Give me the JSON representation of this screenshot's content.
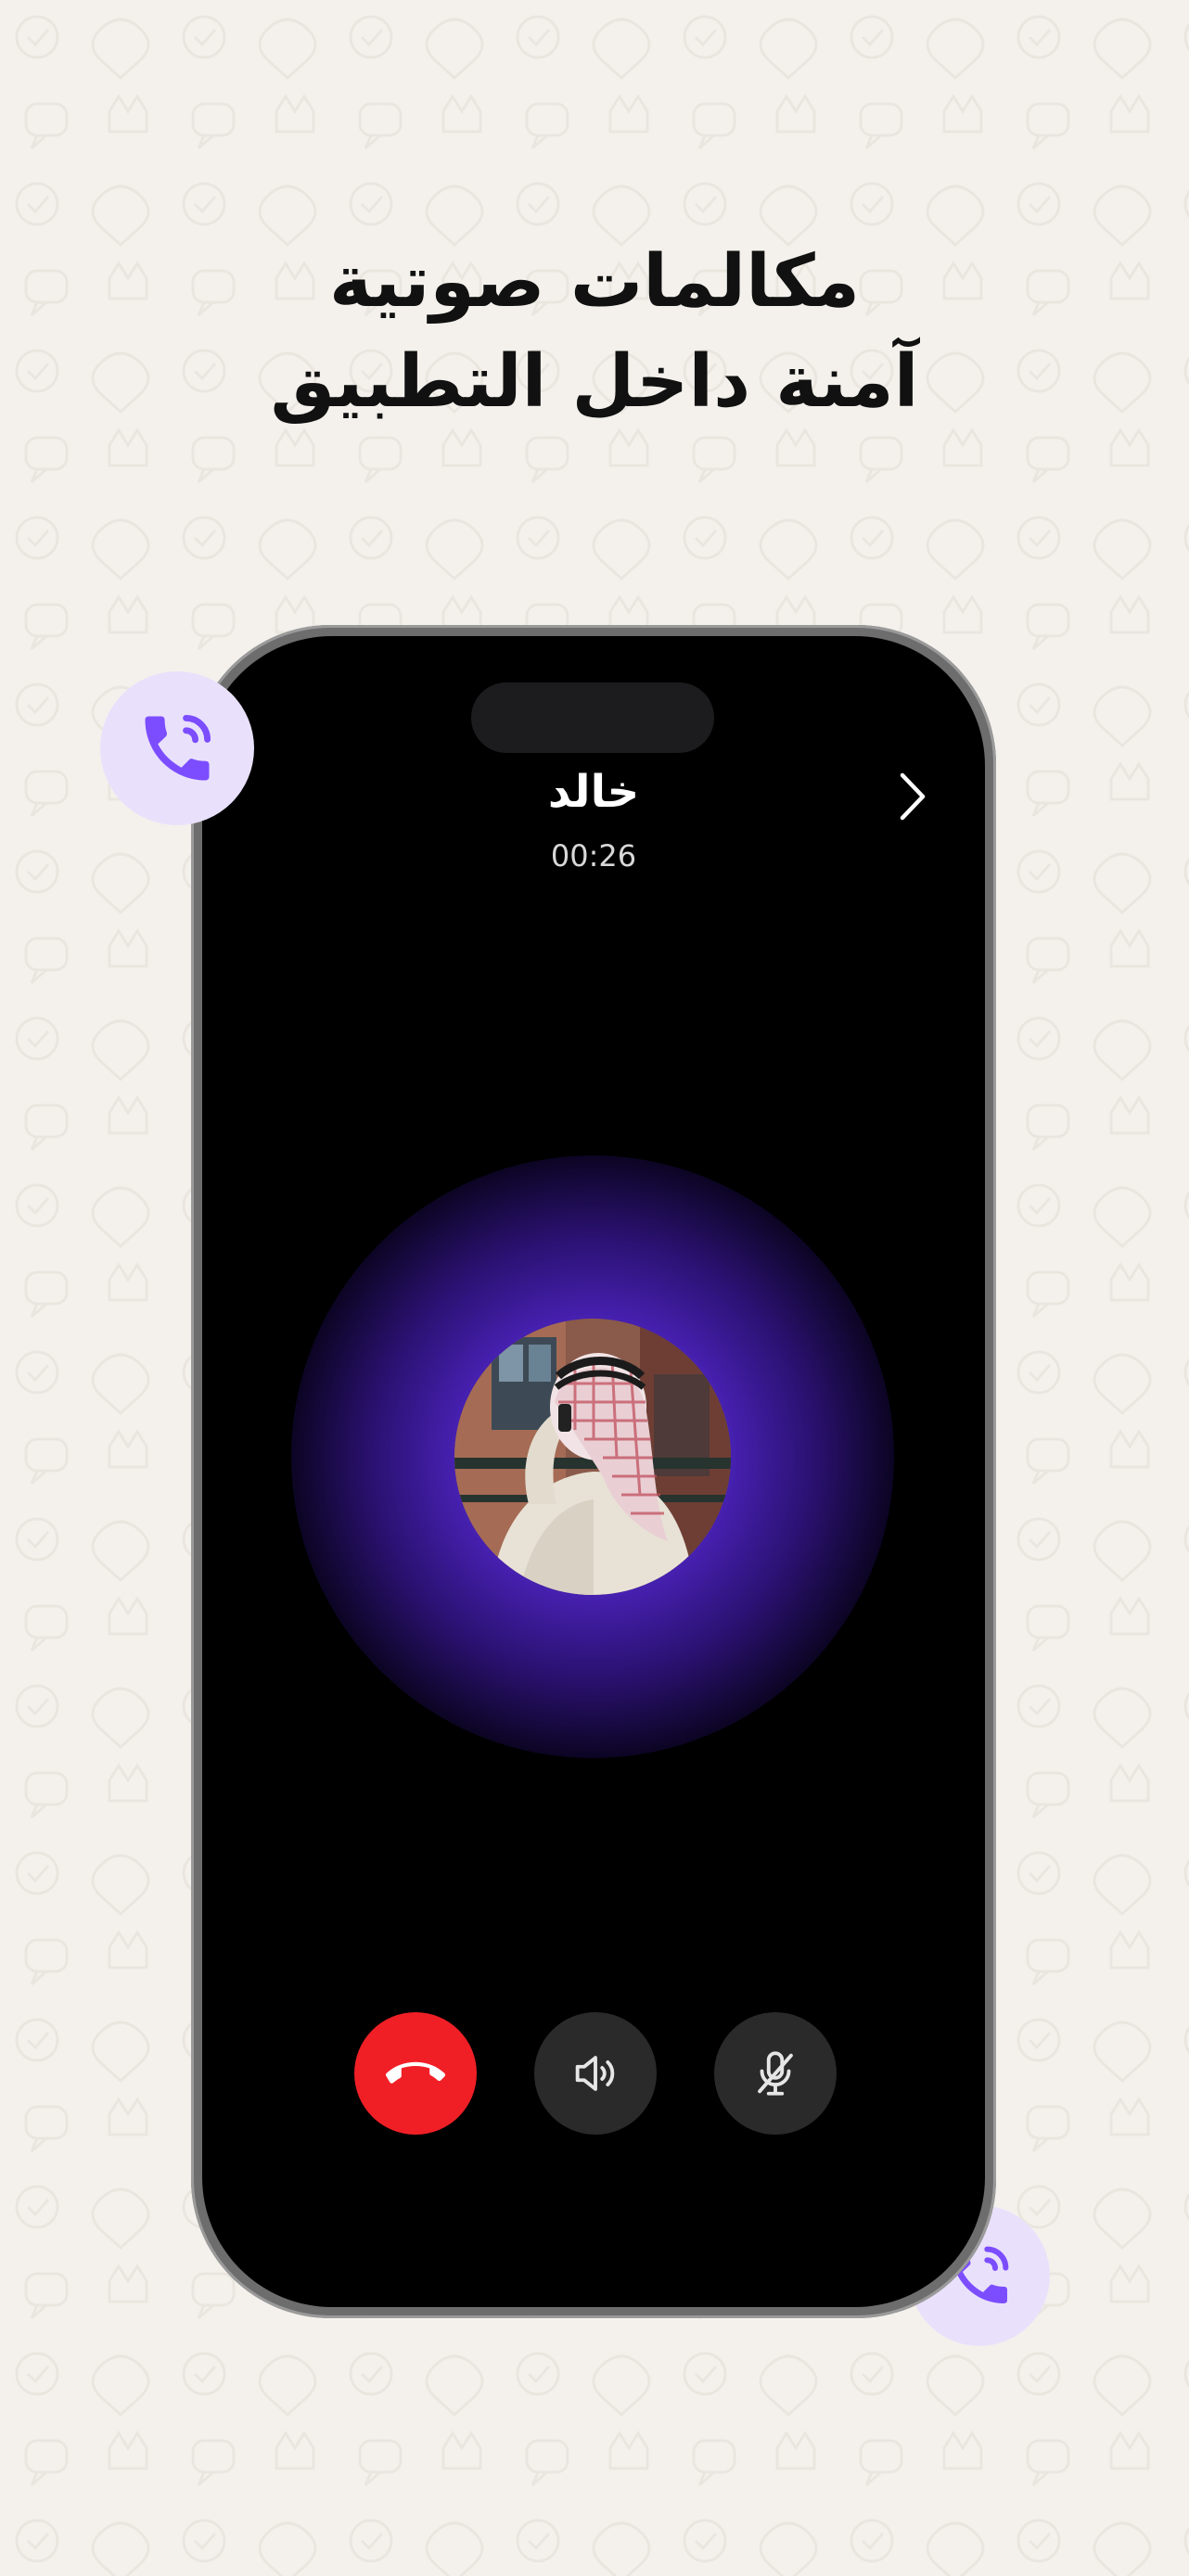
{
  "headline": {
    "line1": "مكالمات صوتية",
    "line2": "آمنة داخل التطبيق"
  },
  "call": {
    "contact_name": "خالد",
    "timer": "00:26"
  },
  "icons": {
    "badge_top": "phone-call-icon",
    "badge_bottom": "phone-call-icon",
    "back": "chevron-right-icon",
    "end_call": "phone-hangup-icon",
    "speaker": "speaker-icon",
    "mute": "mic-off-icon"
  },
  "colors": {
    "background": "#f4f1ec",
    "accent_purple": "#7c4dff",
    "badge_bg": "#e9e1fb",
    "end_call_red": "#f01f26",
    "control_gray": "#2a2a2a",
    "glow_purple": "#5a2fd0"
  }
}
